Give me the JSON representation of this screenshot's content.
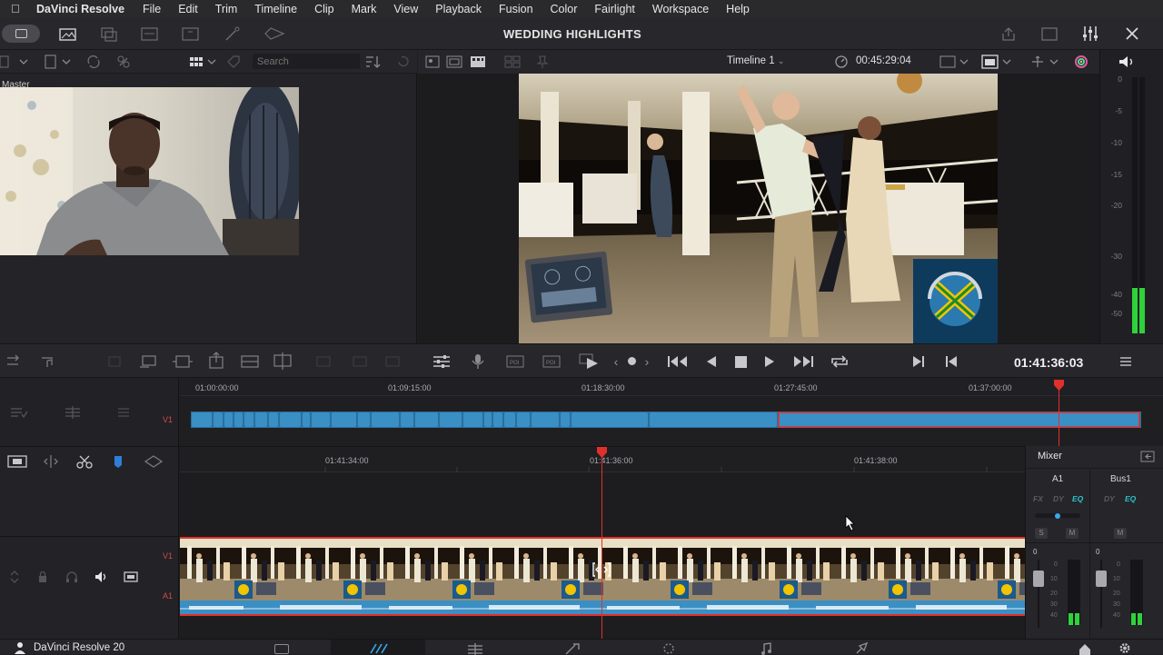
{
  "menubar": {
    "app_name": "DaVinci Resolve",
    "items": [
      "File",
      "Edit",
      "Trim",
      "Timeline",
      "Clip",
      "Mark",
      "View",
      "Playback",
      "Fusion",
      "Color",
      "Fairlight",
      "Workspace",
      "Help"
    ]
  },
  "window": {
    "project_title": "WEDDING HIGHLIGHTS"
  },
  "media_pool": {
    "search_placeholder": "Search",
    "bin_label": "Master"
  },
  "viewer": {
    "timeline_name": "Timeline 1",
    "duration_timecode": "00:45:29:04"
  },
  "meters": {
    "scale": [
      "0",
      "-5",
      "-10",
      "-15",
      "-20",
      "-30",
      "-40",
      "-50"
    ]
  },
  "transport": {
    "current_timecode": "01:41:36:03"
  },
  "upper_timeline": {
    "ruler": [
      "01:00:00:00",
      "01:09:15:00",
      "01:18:30:00",
      "01:27:45:00",
      "01:37:00:00"
    ],
    "track_label": "V1"
  },
  "lower_timeline": {
    "ruler": [
      "01:41:34:00",
      "01:41:36:00",
      "01:41:38:00"
    ],
    "video_track": "V1",
    "audio_track": "A1"
  },
  "mixer": {
    "title": "Mixer",
    "channels": [
      {
        "name": "A1",
        "fx": "FX",
        "dy": "DY",
        "eq": "EQ",
        "solo": "S",
        "mute": "M"
      },
      {
        "name": "Bus1",
        "dy": "DY",
        "eq": "EQ",
        "mute": "M"
      }
    ],
    "fader_scale": [
      "0",
      "0",
      "10",
      "20",
      "30",
      "40"
    ]
  },
  "bottombar": {
    "app_version": "DaVinci Resolve 20"
  },
  "colors": {
    "accent_blue": "#3a8fc4",
    "playhead_red": "#e0302c",
    "eq_teal": "#2ec4c4",
    "meter_green": "#2fd23a"
  }
}
